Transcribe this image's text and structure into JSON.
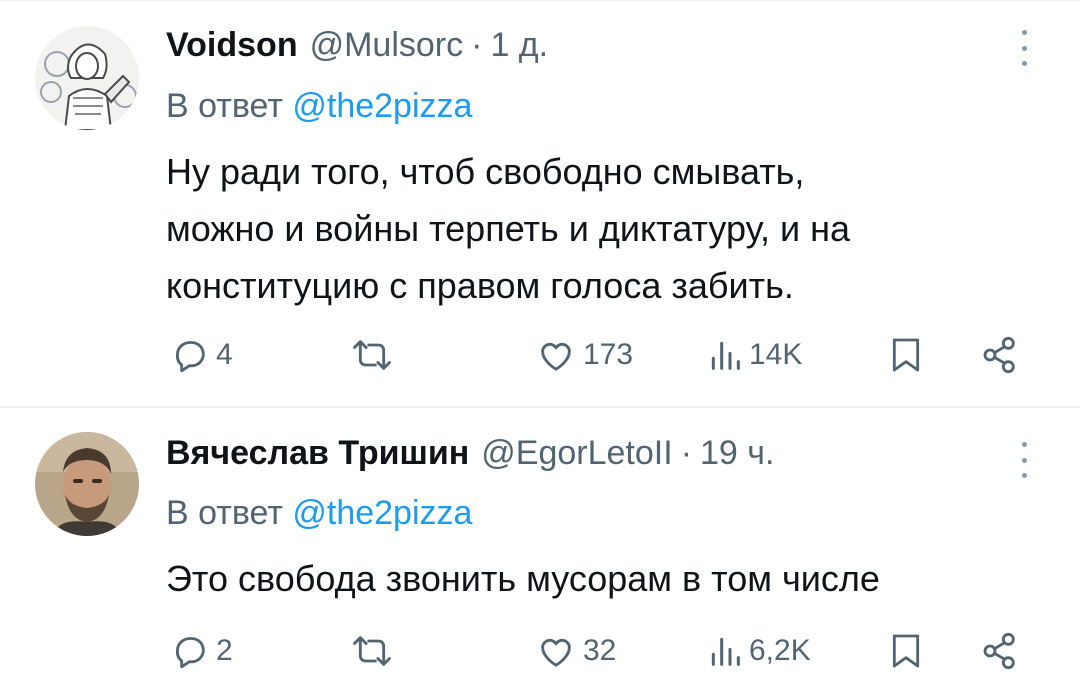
{
  "colors": {
    "text": "#0f1419",
    "secondary": "#536471",
    "link": "#1d9bf0",
    "divider": "#eff3f4"
  },
  "tweets": [
    {
      "display_name": "Voidson",
      "handle": "@Mulsorc",
      "separator": "·",
      "time": "1 д.",
      "reply_prefix": "В ответ",
      "reply_mention": "@the2pizza",
      "text_lines": [
        "Ну ради того, чтоб свободно смывать,",
        "можно и войны терпеть и диктатуру, и на",
        "конституцию с правом голоса забить."
      ],
      "replies": "4",
      "reposts": "",
      "likes": "173",
      "views": "14K",
      "avatar_icon": "avatar-illustration-woman"
    },
    {
      "display_name": "Вячеслав Тришин",
      "handle": "@EgorLetoII",
      "separator": "·",
      "time": "19 ч.",
      "reply_prefix": "В ответ",
      "reply_mention": "@the2pizza",
      "text_lines": [
        "Это свобода звонить мусорам в том числе"
      ],
      "replies": "2",
      "reposts": "",
      "likes": "32",
      "views": "6,2K",
      "avatar_icon": "avatar-photo-man"
    }
  ]
}
